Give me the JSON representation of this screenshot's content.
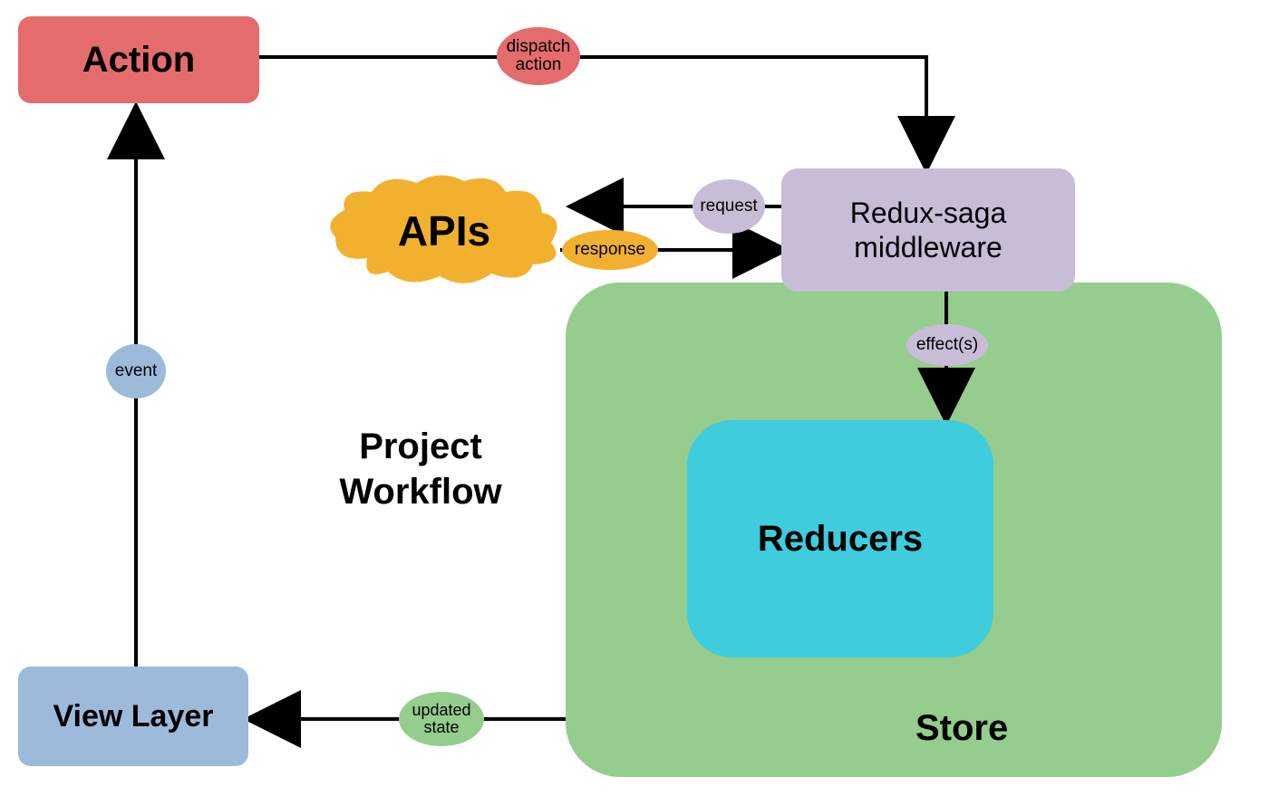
{
  "title": "Project\nWorkflow",
  "nodes": {
    "action": "Action",
    "apis": "APIs",
    "middleware": "Redux-saga\nmiddleware",
    "reducers": "Reducers",
    "store": "Store",
    "view": "View Layer"
  },
  "edges": {
    "dispatch": "dispatch\naction",
    "request": "request",
    "response": "response",
    "effects": "effect(s)",
    "event": "event",
    "updated": "updated\nstate"
  }
}
